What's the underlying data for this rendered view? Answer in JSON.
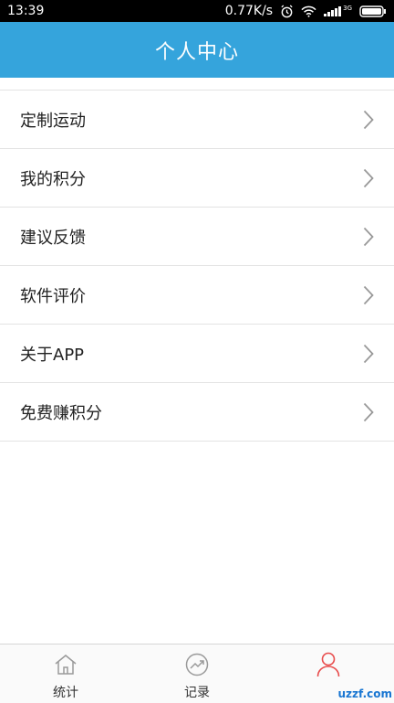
{
  "status_bar": {
    "time": "13:39",
    "speed": "0.77K/s",
    "network": "3G"
  },
  "header": {
    "title": "个人中心",
    "bg_color": "#35a4dc"
  },
  "menu": {
    "items": [
      {
        "label": "定制运动"
      },
      {
        "label": "我的积分"
      },
      {
        "label": "建议反馈"
      },
      {
        "label": "软件评价"
      },
      {
        "label": "关于APP"
      },
      {
        "label": "免费赚积分"
      }
    ]
  },
  "tabs": [
    {
      "label": "统计",
      "icon": "home-icon",
      "active": false
    },
    {
      "label": "记录",
      "icon": "trend-chart-icon",
      "active": false
    },
    {
      "label": "",
      "icon": "user-icon",
      "active": true
    }
  ],
  "colors": {
    "accent": "#35a4dc",
    "active_tab": "#e84b4b",
    "divider": "#e3e3e3"
  },
  "watermark": {
    "text": "uzzf.com"
  }
}
